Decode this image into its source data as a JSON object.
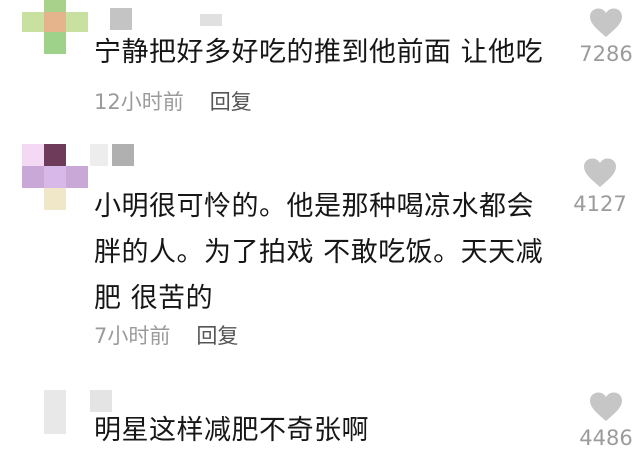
{
  "comments": [
    {
      "text_lines": [
        "宁静把好多好吃的推到他前面 让他吃"
      ],
      "time": "12小时前",
      "reply": "回复",
      "likes": "7286",
      "avatar_colors": [
        "#a8d18c",
        "#e6b48c",
        "#c8e0a0",
        "#9ed28a"
      ],
      "name_block_colors": [
        "#c4c4c4",
        "#e0e0e0"
      ]
    },
    {
      "text_lines": [
        "小明很可怜的。他是那种喝凉水都会",
        "胖的人。为了拍戏 不敢吃饭。天天减",
        "肥 很苦的"
      ],
      "time": "7小时前",
      "reply": "回复",
      "likes": "4127",
      "avatar_colors": [
        "#f3d9f3",
        "#6e3c5a",
        "#c9a8d8",
        "#d8b8e8",
        "#f0e6c8"
      ],
      "name_block_colors": [
        "#d8d8d8",
        "#b0b0b0"
      ]
    },
    {
      "text_lines": [
        "明星这样减肥不奇张啊"
      ],
      "likes": "4486",
      "avatar_colors": [
        "#e8e8e8"
      ],
      "name_block_colors": [
        "#e4e4e4"
      ]
    }
  ]
}
